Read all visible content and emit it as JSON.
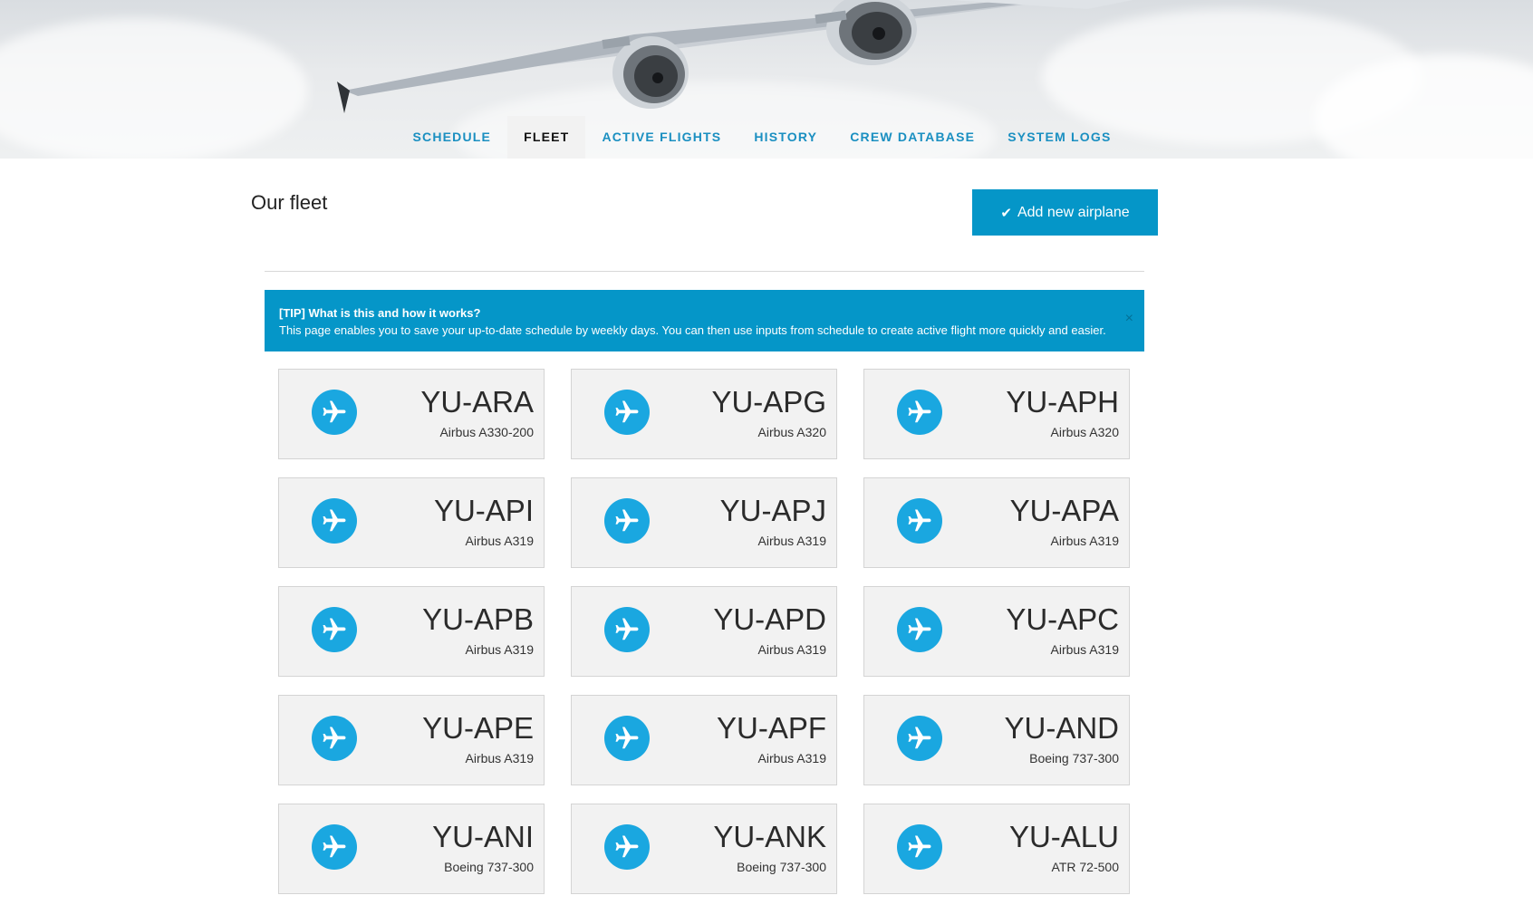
{
  "nav": {
    "tabs": [
      {
        "label": "SCHEDULE",
        "active": false
      },
      {
        "label": "FLEET",
        "active": true
      },
      {
        "label": "ACTIVE FLIGHTS",
        "active": false
      },
      {
        "label": "HISTORY",
        "active": false
      },
      {
        "label": "CREW DATABASE",
        "active": false
      },
      {
        "label": "SYSTEM LOGS",
        "active": false
      }
    ]
  },
  "main": {
    "title": "Our fleet",
    "add_button_label": "Add new airplane",
    "add_button_icon": "check-icon"
  },
  "tip": {
    "title": "[TIP] What is this and how it works?",
    "text": "This page enables you to save your up-to-date schedule by weekly days. You can then use inputs from schedule to create active flight more quickly and easier.",
    "close_symbol": "×"
  },
  "fleet": [
    {
      "registration": "YU-ARA",
      "model": "Airbus A330-200"
    },
    {
      "registration": "YU-APG",
      "model": "Airbus A320"
    },
    {
      "registration": "YU-APH",
      "model": "Airbus A320"
    },
    {
      "registration": "YU-API",
      "model": "Airbus A319"
    },
    {
      "registration": "YU-APJ",
      "model": "Airbus A319"
    },
    {
      "registration": "YU-APA",
      "model": "Airbus A319"
    },
    {
      "registration": "YU-APB",
      "model": "Airbus A319"
    },
    {
      "registration": "YU-APD",
      "model": "Airbus A319"
    },
    {
      "registration": "YU-APC",
      "model": "Airbus A319"
    },
    {
      "registration": "YU-APE",
      "model": "Airbus A319"
    },
    {
      "registration": "YU-APF",
      "model": "Airbus A319"
    },
    {
      "registration": "YU-AND",
      "model": "Boeing 737-300"
    },
    {
      "registration": "YU-ANI",
      "model": "Boeing 737-300"
    },
    {
      "registration": "YU-ANK",
      "model": "Boeing 737-300"
    },
    {
      "registration": "YU-ALU",
      "model": "ATR 72-500"
    }
  ],
  "colors": {
    "accent": "#0596c8",
    "icon_circle": "#1aa7e0",
    "nav_text": "#1a8fc1",
    "card_bg": "#f2f2f2"
  }
}
